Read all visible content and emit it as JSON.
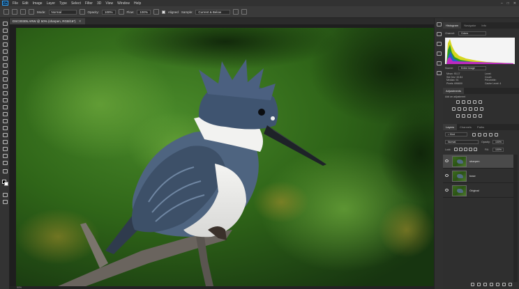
{
  "menu": {
    "logo": "Ps",
    "items": [
      "File",
      "Edit",
      "Image",
      "Layer",
      "Type",
      "Select",
      "Filter",
      "3D",
      "View",
      "Window",
      "Help"
    ]
  },
  "options_bar": {
    "mode_label": "Mode:",
    "mode_value": "Normal",
    "opacity_label": "Opacity:",
    "opacity_value": "100%",
    "flow_label": "Flow:",
    "flow_value": "100%",
    "aligned_label": "Aligned",
    "sample_label": "Sample:",
    "sample_value": "Current & Below"
  },
  "document": {
    "tab_title": "DSC00305.ARW @ 50% (sharpen, RGB/16*)",
    "status": "50%"
  },
  "histogram_panel": {
    "tabs": [
      "Histogram",
      "Navigator",
      "Info"
    ],
    "channel_label": "Channel:",
    "channel_value": "Colors",
    "source_label": "Source:",
    "source_value": "Entire Image",
    "stats_left": [
      {
        "label": "Mean:",
        "value": "93.17"
      },
      {
        "label": "Std Dev:",
        "value": "32.84"
      },
      {
        "label": "Median:",
        "value": "91"
      },
      {
        "label": "Pixels:",
        "value": "696600"
      }
    ],
    "stats_right": [
      {
        "label": "Level:",
        "value": ""
      },
      {
        "label": "Count:",
        "value": ""
      },
      {
        "label": "Percentile:",
        "value": ""
      },
      {
        "label": "Cache Level:",
        "value": "4"
      }
    ]
  },
  "adjustments_panel": {
    "title": "Adjustments",
    "subtitle": "Add an adjustment"
  },
  "layers_panel": {
    "tabs": [
      "Layers",
      "Channels",
      "Paths"
    ],
    "kind_label": "Kind",
    "blend_mode": "Normal",
    "opacity_label": "Opacity:",
    "opacity_value": "100%",
    "lock_label": "Lock:",
    "fill_label": "Fill:",
    "fill_value": "100%",
    "layers": [
      {
        "name": "sharpen",
        "selected": true
      },
      {
        "name": "base",
        "selected": false
      },
      {
        "name": "Original",
        "selected": false
      }
    ]
  },
  "icons": {
    "window_controls": [
      "minimize-icon",
      "maximize-icon",
      "close-icon"
    ]
  },
  "colors": {
    "accent": "#31a8ff",
    "panel_bg": "#2f2f2f",
    "selected_layer": "#4a4a4a"
  }
}
